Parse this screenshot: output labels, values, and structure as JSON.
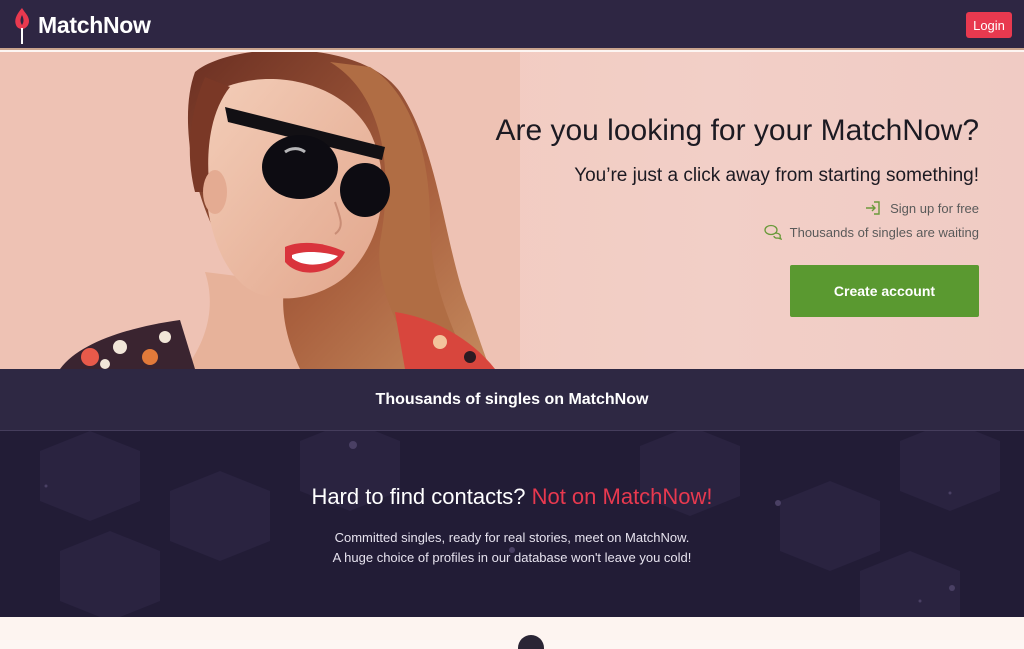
{
  "header": {
    "brand": "MatchNow",
    "login_label": "Login"
  },
  "hero": {
    "title": "Are you looking for your MatchNow?",
    "subtitle": "You’re just a click away from starting something!",
    "features": [
      {
        "icon": "sign-in-icon",
        "label": "Sign up for free"
      },
      {
        "icon": "chat-bubbles-icon",
        "label": "Thousands of singles are waiting"
      }
    ],
    "cta_label": "Create account"
  },
  "band": {
    "text": "Thousands of singles on MatchNow"
  },
  "contacts": {
    "title_main": "Hard to find contacts?",
    "title_accent": "Not on MatchNow!",
    "line1": "Committed singles, ready for real stories, meet on MatchNow.",
    "line2": "A huge choice of profiles in our database won't leave you cold!"
  },
  "colors": {
    "nav_bg": "#2e2643",
    "accent_red": "#e8394f",
    "cta_green": "#5a9930",
    "band_bg": "#2e2843",
    "section_bg": "#221c36"
  }
}
